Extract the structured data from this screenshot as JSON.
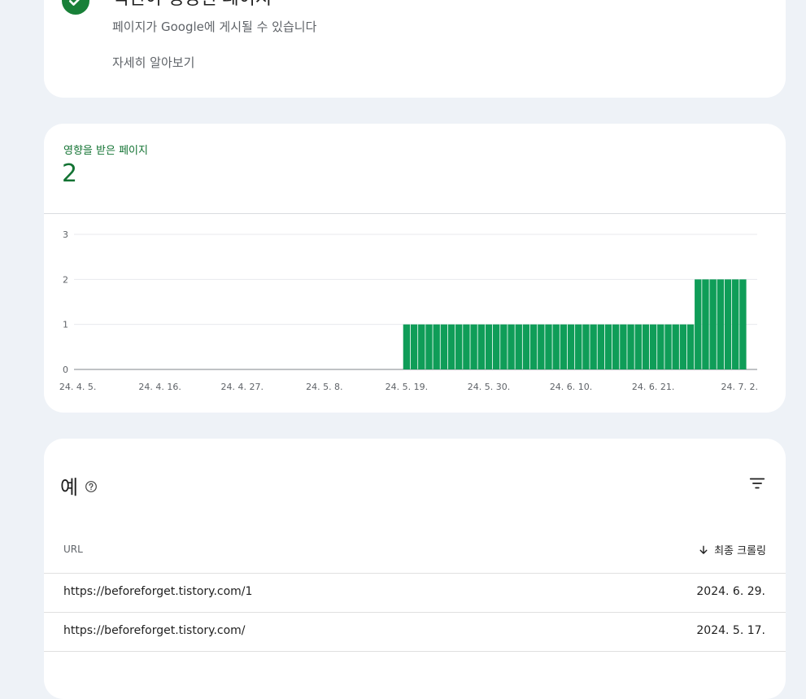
{
  "status": {
    "title": "색인이 생성된 페이지",
    "subtitle": "페이지가 Google에 게시될 수 있습니다",
    "learn_more": "자세히 알아보기",
    "accent": "#188038"
  },
  "metric": {
    "label": "영향을 받은 페이지",
    "value": "2",
    "color": "#137333"
  },
  "chart_data": {
    "type": "bar",
    "color": "#0f9d58",
    "ylim": [
      0,
      3
    ],
    "yticks": [
      "0",
      "1",
      "2",
      "3"
    ],
    "xticks": [
      "24. 4. 5.",
      "24. 4. 16.",
      "24. 4. 27.",
      "24. 5. 8.",
      "24. 5. 19.",
      "24. 5. 30.",
      "24. 6. 10.",
      "24. 6. 21.",
      "24. 7. 2."
    ],
    "grid": true,
    "x_start": "2024-04-05",
    "days": 90,
    "segments": [
      {
        "from": "2024-04-05",
        "to": "2024-05-18",
        "value": 0
      },
      {
        "from": "2024-05-19",
        "to": "2024-06-26",
        "value": 1
      },
      {
        "from": "2024-06-27",
        "to": "2024-07-03",
        "value": 2
      }
    ]
  },
  "table": {
    "title": "예",
    "col_url": "URL",
    "col_crawl": "최종 크롤링",
    "rows": [
      {
        "url": "https://beforeforget.tistory.com/1",
        "date": "2024. 6. 29."
      },
      {
        "url": "https://beforeforget.tistory.com/",
        "date": "2024. 5. 17."
      }
    ]
  }
}
